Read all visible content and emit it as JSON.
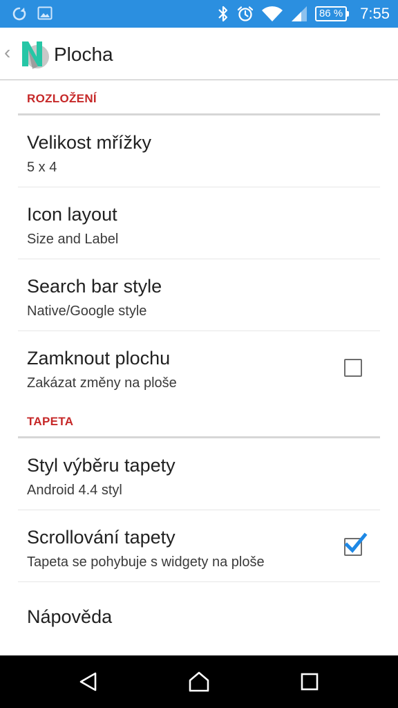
{
  "status_bar": {
    "left_icons": [
      "sync-icon",
      "image-icon"
    ],
    "right_icons": [
      "bluetooth-icon",
      "alarm-icon",
      "wifi-icon",
      "signal-icon"
    ],
    "battery_percent": "86 %",
    "time": "7:55",
    "background_color": "#2b8fe0"
  },
  "app_bar": {
    "title": "Plocha",
    "logo_icon": "nova-launcher-logo-icon",
    "back_icon": "chevron-left-icon"
  },
  "sections": [
    {
      "header": "ROZLOŽENÍ",
      "items": [
        {
          "title": "Velikost mřížky",
          "summary": "5 x 4"
        },
        {
          "title": "Icon layout",
          "summary": "Size and Label"
        },
        {
          "title": "Search bar style",
          "summary": "Native/Google style"
        },
        {
          "title": "Zamknout plochu",
          "summary": "Zakázat změny na ploše",
          "checkbox": false
        }
      ]
    },
    {
      "header": "TAPETA",
      "items": [
        {
          "title": "Styl výběru tapety",
          "summary": "Android 4.4 styl"
        },
        {
          "title": "Scrollování tapety",
          "summary": "Tapeta se pohybuje s widgety na ploše",
          "checkbox": true
        },
        {
          "title": "Nápověda"
        }
      ]
    }
  ],
  "nav_bar": {
    "buttons": [
      "back-icon",
      "home-icon",
      "recents-icon"
    ]
  },
  "colors": {
    "accent": "#c62828",
    "checkbox_check": "#1e88e5"
  }
}
